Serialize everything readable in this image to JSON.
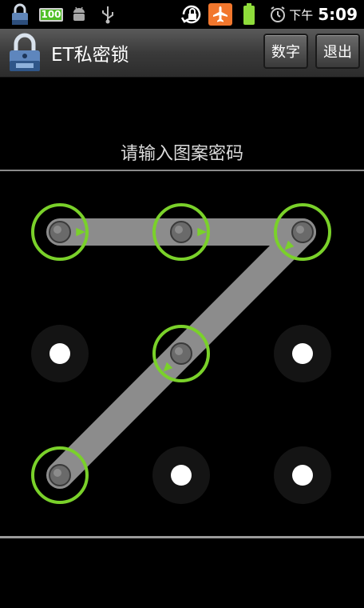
{
  "status_bar": {
    "battery_level_text": "100",
    "time_ampm": "下午",
    "time": "5:09",
    "icons": [
      "lock-notification-icon",
      "battery-100-icon",
      "android-debug-icon",
      "usb-icon",
      "screen-rotation-lock-icon",
      "airplane-mode-icon",
      "battery-icon",
      "alarm-clock-icon"
    ]
  },
  "title_bar": {
    "title": "ET私密锁",
    "numeric_button_label": "数字",
    "exit_button_label": "退出"
  },
  "prompt": "请输入图案密码",
  "pattern": {
    "grid": 3,
    "selected_sequence": [
      1,
      2,
      3,
      5,
      7
    ],
    "colors": {
      "ring": "#7ad12a",
      "trail": "#8c8c8c",
      "arrow": "#7ad12a",
      "dot": "#ffffff"
    }
  }
}
